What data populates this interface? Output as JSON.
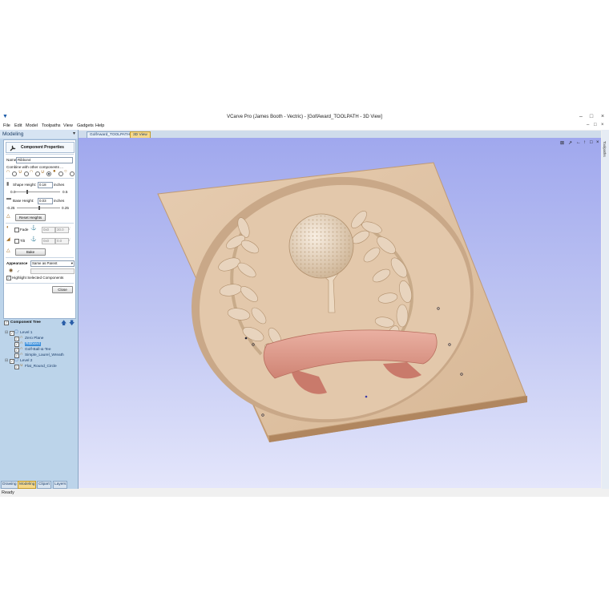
{
  "window": {
    "title": "VCarve Pro (James Booth - Vectric) - [GolfAward_TOOLPATH - 3D View]",
    "controls": [
      "–",
      "□",
      "×"
    ]
  },
  "menu": {
    "items": [
      "File",
      "Edit",
      "Model",
      "Toolpaths",
      "View",
      "Gadgets",
      "Help"
    ],
    "controls": [
      "–",
      "□",
      "×"
    ]
  },
  "left_panel": {
    "title": "Modeling",
    "pin": "▾",
    "props": {
      "heading": "Component Properties",
      "name_label": "Name",
      "name_value": "Ribbon4",
      "combine_label": "Combine with other components ...",
      "shape_height_label": "Shape Height:",
      "shape_height_value": "0.18",
      "shape_height_unit": "inches",
      "shape_min": "0.0",
      "shape_max": "0.5",
      "base_height_label": "Base Height:",
      "base_height_value": "0.03",
      "base_height_unit": "inches",
      "base_min": "-0.25",
      "base_max": "0.25",
      "reset_label": "Reset Heights",
      "fade_label": "Fade",
      "fade_v1": "0x0",
      "fade_v2": "30.0",
      "tilt_label": "Tilt",
      "tilt_v1": "0x0",
      "tilt_v2": "0.0",
      "bake_label": "Bake",
      "appearance_label": "Appearance",
      "appearance_value": "Same as Parent",
      "highlight_label": "Highlight Selected Components",
      "close_label": "Close"
    },
    "tree": {
      "title": "Component Tree",
      "items": [
        {
          "label": "Level 1"
        },
        {
          "label": "Zero Plane"
        },
        {
          "label": "Ribbon4"
        },
        {
          "label": "Golf-Ball-&-Tee"
        },
        {
          "label": "Simple_Laurel_Wreath"
        },
        {
          "label": "Level 2"
        },
        {
          "label": "Flat_Round_Circle"
        }
      ]
    },
    "tabs": [
      "Drawing",
      "Modeling",
      "Clipart",
      "Layers"
    ]
  },
  "doc_tabs": [
    "GolfAward_TOOLPATH",
    "3D View"
  ],
  "view_icons": [
    "⊠",
    "↗",
    "←",
    "↑",
    "□",
    "×"
  ],
  "right_strip": {
    "label": "Toolpaths"
  },
  "status": "Ready",
  "colors": {
    "wood": "#e2c7aa",
    "ribbon": "#df9a8c",
    "view_top": "#a0a8ee",
    "panel": "#bcd4ea"
  }
}
